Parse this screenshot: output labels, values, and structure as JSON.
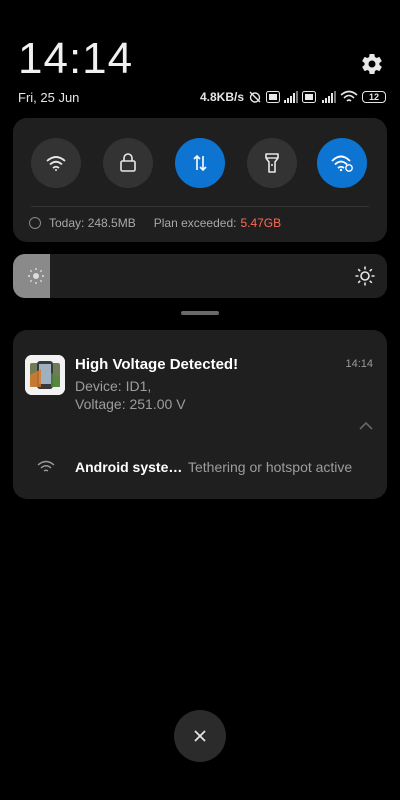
{
  "header": {
    "time": "14:14",
    "date": "Fri, 25 Jun",
    "network_speed": "4.8KB/s",
    "battery": "12",
    "settings_icon": "gear-icon"
  },
  "quick_settings": {
    "tiles": [
      {
        "name": "wifi",
        "icon": "wifi-icon",
        "active": false
      },
      {
        "name": "lock",
        "icon": "lock-icon",
        "active": false
      },
      {
        "name": "mobile-data",
        "icon": "data-transfer-icon",
        "active": true
      },
      {
        "name": "flashlight",
        "icon": "flashlight-icon",
        "active": false
      },
      {
        "name": "hotspot",
        "icon": "hotspot-icon",
        "active": true
      }
    ],
    "data_usage": {
      "today": "Today: 248.5MB",
      "plan_label": "Plan exceeded:",
      "plan_value": "5.47GB"
    },
    "accent_color": "#0d74d2"
  },
  "brightness": {
    "level": 0.1
  },
  "notifications": {
    "primary": {
      "title": "High Voltage Detected!",
      "time": "14:14",
      "line1": "Device: ID1,",
      "line2": "Voltage: 251.00 V"
    },
    "secondary": {
      "app": "Android syste…",
      "text": "Tethering or hotspot active"
    }
  },
  "close_icon": "close-icon"
}
